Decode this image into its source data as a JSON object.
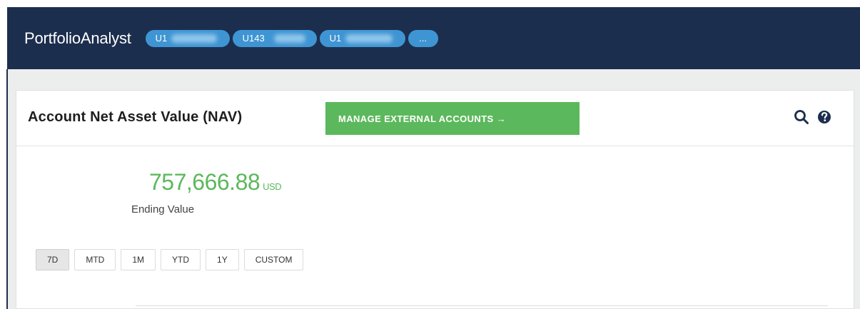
{
  "header": {
    "app_title": "PortfolioAnalyst",
    "accounts": [
      {
        "label": "U1"
      },
      {
        "label": "U143"
      },
      {
        "label": "U1"
      }
    ],
    "more_label": "...",
    "background_color": "#1c2e4e",
    "pill_color": "#3f95d3"
  },
  "panel": {
    "title": "Account Net Asset Value (NAV)",
    "manage_button_label": "MANAGE EXTERNAL ACCOUNTS →",
    "manage_button_color": "#5cb85c",
    "icons": [
      "search-icon",
      "question-circle-icon"
    ]
  },
  "nav": {
    "value": "757,666.88",
    "currency": "USD",
    "label": "Ending Value",
    "value_color": "#5cb85c"
  },
  "ranges": {
    "selected": "7D",
    "options": [
      "7D",
      "MTD",
      "1M",
      "YTD",
      "1Y",
      "CUSTOM"
    ]
  }
}
